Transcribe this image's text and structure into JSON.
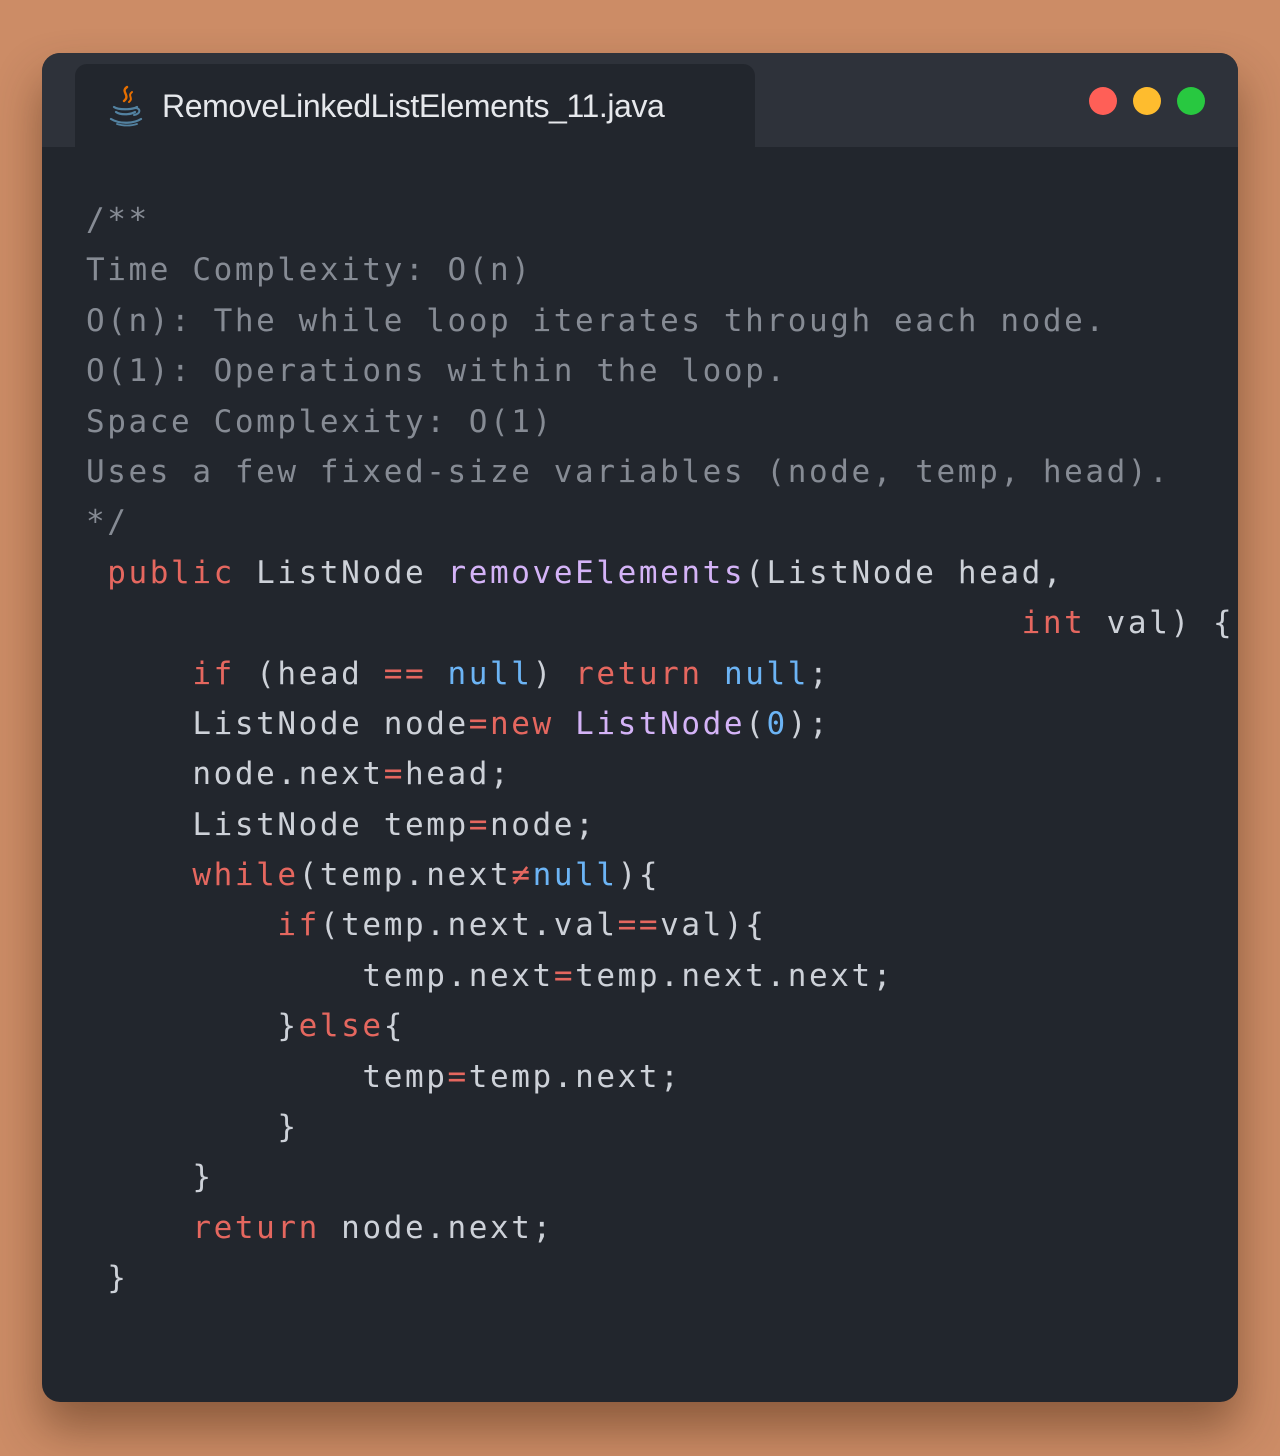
{
  "window": {
    "tab_title": "RemoveLinkedListElements_11.java",
    "tab_icon": "java-icon",
    "controls": [
      "close-button",
      "minimize-button",
      "maximize-button"
    ],
    "colors": {
      "background": "#cc8c66",
      "window": "#22262d",
      "titlebar": "#2e323a",
      "close": "#ff5f57",
      "minimize": "#febc2e",
      "maximize": "#28c840",
      "comment": "#868b94",
      "keyword": "#e5675f",
      "function": "#d4b3f7",
      "literal": "#6cb4f5",
      "text": "#cdd1d8"
    }
  },
  "code": {
    "language": "java",
    "lines": [
      [
        {
          "t": "/**",
          "c": "cm"
        }
      ],
      [
        {
          "t": "Time Complexity: O(n)",
          "c": "cm"
        }
      ],
      [
        {
          "t": "O(n): The while loop iterates through each node.",
          "c": "cm"
        }
      ],
      [
        {
          "t": "O(1): Operations within the loop.",
          "c": "cm"
        }
      ],
      [
        {
          "t": "Space Complexity: O(1)",
          "c": "cm"
        }
      ],
      [
        {
          "t": "Uses a few fixed-size variables (node, temp, head).",
          "c": "cm"
        }
      ],
      [
        {
          "t": "*/",
          "c": "cm"
        }
      ],
      [
        {
          "t": " ",
          "c": "pl"
        },
        {
          "t": "public",
          "c": "kw"
        },
        {
          "t": " ListNode ",
          "c": "pl"
        },
        {
          "t": "removeElements",
          "c": "fn"
        },
        {
          "t": "(ListNode head,",
          "c": "pl"
        }
      ],
      [
        {
          "t": "                                            ",
          "c": "pl"
        },
        {
          "t": "int",
          "c": "kw"
        },
        {
          "t": " val) {",
          "c": "pl"
        }
      ],
      [
        {
          "t": "     ",
          "c": "pl"
        },
        {
          "t": "if",
          "c": "kw"
        },
        {
          "t": " (head ",
          "c": "pl"
        },
        {
          "t": "==",
          "c": "op"
        },
        {
          "t": " ",
          "c": "pl"
        },
        {
          "t": "null",
          "c": "lt"
        },
        {
          "t": ") ",
          "c": "pl"
        },
        {
          "t": "return",
          "c": "kw"
        },
        {
          "t": " ",
          "c": "pl"
        },
        {
          "t": "null",
          "c": "lt"
        },
        {
          "t": ";",
          "c": "pl"
        }
      ],
      [
        {
          "t": "     ListNode node",
          "c": "pl"
        },
        {
          "t": "=",
          "c": "op"
        },
        {
          "t": "new",
          "c": "kw"
        },
        {
          "t": " ",
          "c": "pl"
        },
        {
          "t": "ListNode",
          "c": "fn"
        },
        {
          "t": "(",
          "c": "pl"
        },
        {
          "t": "0",
          "c": "lt"
        },
        {
          "t": ");",
          "c": "pl"
        }
      ],
      [
        {
          "t": "     node.next",
          "c": "pl"
        },
        {
          "t": "=",
          "c": "op"
        },
        {
          "t": "head;",
          "c": "pl"
        }
      ],
      [
        {
          "t": "     ListNode temp",
          "c": "pl"
        },
        {
          "t": "=",
          "c": "op"
        },
        {
          "t": "node;",
          "c": "pl"
        }
      ],
      [
        {
          "t": "     ",
          "c": "pl"
        },
        {
          "t": "while",
          "c": "kw"
        },
        {
          "t": "(temp.next",
          "c": "pl"
        },
        {
          "t": "≠",
          "c": "op"
        },
        {
          "t": "null",
          "c": "lt"
        },
        {
          "t": "){",
          "c": "pl"
        }
      ],
      [
        {
          "t": "         ",
          "c": "pl"
        },
        {
          "t": "if",
          "c": "kw"
        },
        {
          "t": "(temp.next.val",
          "c": "pl"
        },
        {
          "t": "==",
          "c": "op"
        },
        {
          "t": "val){",
          "c": "pl"
        }
      ],
      [
        {
          "t": "             temp.next",
          "c": "pl"
        },
        {
          "t": "=",
          "c": "op"
        },
        {
          "t": "temp.next.next;",
          "c": "pl"
        }
      ],
      [
        {
          "t": "         }",
          "c": "pl"
        },
        {
          "t": "else",
          "c": "kw"
        },
        {
          "t": "{",
          "c": "pl"
        }
      ],
      [
        {
          "t": "             temp",
          "c": "pl"
        },
        {
          "t": "=",
          "c": "op"
        },
        {
          "t": "temp.next;",
          "c": "pl"
        }
      ],
      [
        {
          "t": "         }",
          "c": "pl"
        }
      ],
      [
        {
          "t": "     }",
          "c": "pl"
        }
      ],
      [
        {
          "t": "     ",
          "c": "pl"
        },
        {
          "t": "return",
          "c": "kw"
        },
        {
          "t": " node.next;",
          "c": "pl"
        }
      ],
      [
        {
          "t": " }",
          "c": "pl"
        }
      ]
    ]
  }
}
